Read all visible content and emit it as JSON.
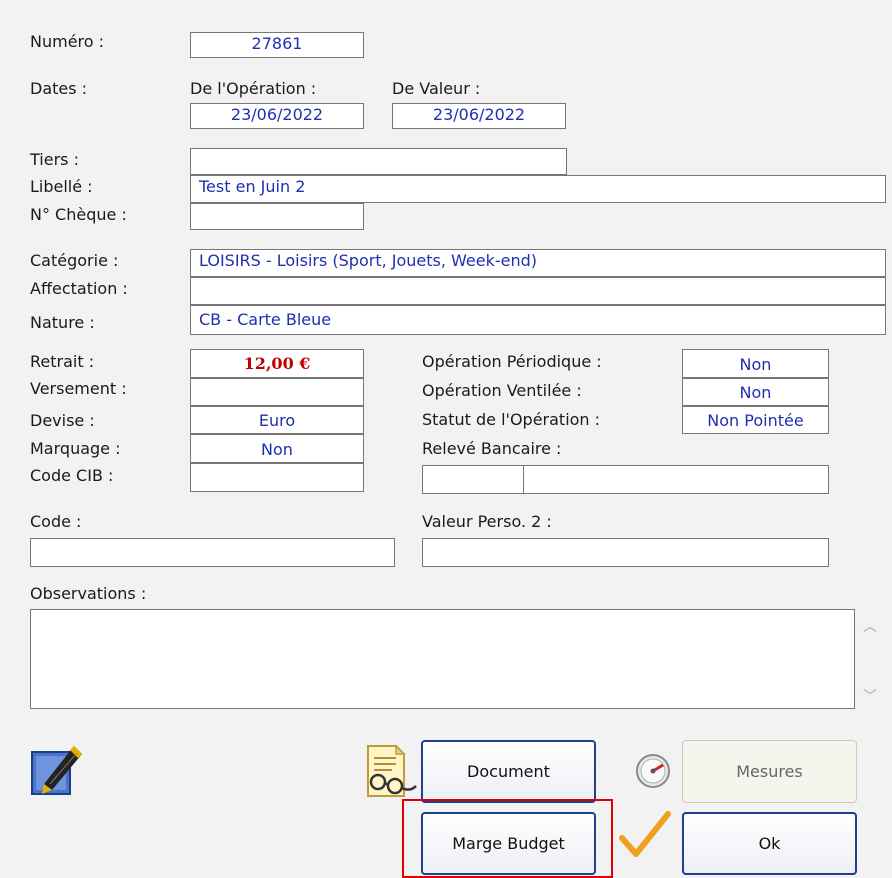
{
  "labels": {
    "numero": "Numéro :",
    "dates": "Dates :",
    "de_operation": "De l'Opération :",
    "de_valeur": "De Valeur :",
    "tiers": "Tiers :",
    "libelle": "Libellé :",
    "no_cheque": "N° Chèque :",
    "categorie": "Catégorie :",
    "affectation": "Affectation :",
    "nature": "Nature :",
    "retrait": "Retrait :",
    "versement": "Versement :",
    "devise": "Devise :",
    "marquage": "Marquage :",
    "code_cib": "Code CIB :",
    "operation_periodique": "Opération Périodique :",
    "operation_ventilee": "Opération Ventilée :",
    "statut_operation": "Statut de l'Opération :",
    "releve_bancaire": "Relevé Bancaire :",
    "code": "Code :",
    "valeur_perso_2": "Valeur Perso. 2 :",
    "observations": "Observations :"
  },
  "values": {
    "numero": "27861",
    "date_operation": "23/06/2022",
    "date_valeur": "23/06/2022",
    "tiers": "",
    "libelle": "Test en Juin 2",
    "no_cheque": "",
    "categorie": "LOISIRS - Loisirs (Sport, Jouets, Week-end)",
    "affectation": "",
    "nature": "CB - Carte Bleue",
    "retrait": "12,00 €",
    "versement": "",
    "devise": "Euro",
    "marquage": "Non",
    "code_cib": "",
    "operation_periodique": "Non",
    "operation_ventilee": "Non",
    "statut_operation": "Non Pointée",
    "releve_bancaire_a": "",
    "releve_bancaire_b": "",
    "code": "",
    "valeur_perso_2": "",
    "observations": ""
  },
  "buttons": {
    "document": "Document",
    "mesures": "Mesures",
    "marge_budget": "Marge Budget",
    "ok": "Ok"
  },
  "colors": {
    "value_text": "#1e2fb4",
    "retrait_text": "#c00000",
    "highlight_box": "#e00000",
    "button_border": "#1f3f8f",
    "checkmark": "#f0a020"
  }
}
